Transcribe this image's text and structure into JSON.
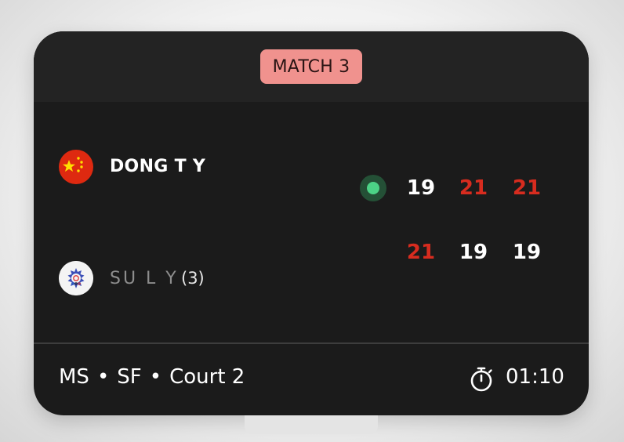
{
  "match": {
    "label": "MATCH 3"
  },
  "players": [
    {
      "name": "DONG T Y",
      "seed": "",
      "flag_icon": "china-flag-icon",
      "serving": true,
      "scores": [
        {
          "value": "19",
          "won": false
        },
        {
          "value": "21",
          "won": true
        },
        {
          "value": "21",
          "won": true
        }
      ]
    },
    {
      "name": "SU L Y",
      "seed": "(3)",
      "flag_icon": "chinese-taipei-flag-icon",
      "serving": false,
      "scores": [
        {
          "value": "21",
          "won": true
        },
        {
          "value": "19",
          "won": false
        },
        {
          "value": "19",
          "won": false
        }
      ]
    }
  ],
  "footer": {
    "event": "MS",
    "round": "SF",
    "court": "Court 2",
    "separator": "•",
    "duration": "01:10",
    "timer_icon": "stopwatch-icon"
  },
  "colors": {
    "card": "#1b1b1b",
    "badge": "#f0928e",
    "win_score": "#d72c1f",
    "serve": "#4cd286"
  }
}
